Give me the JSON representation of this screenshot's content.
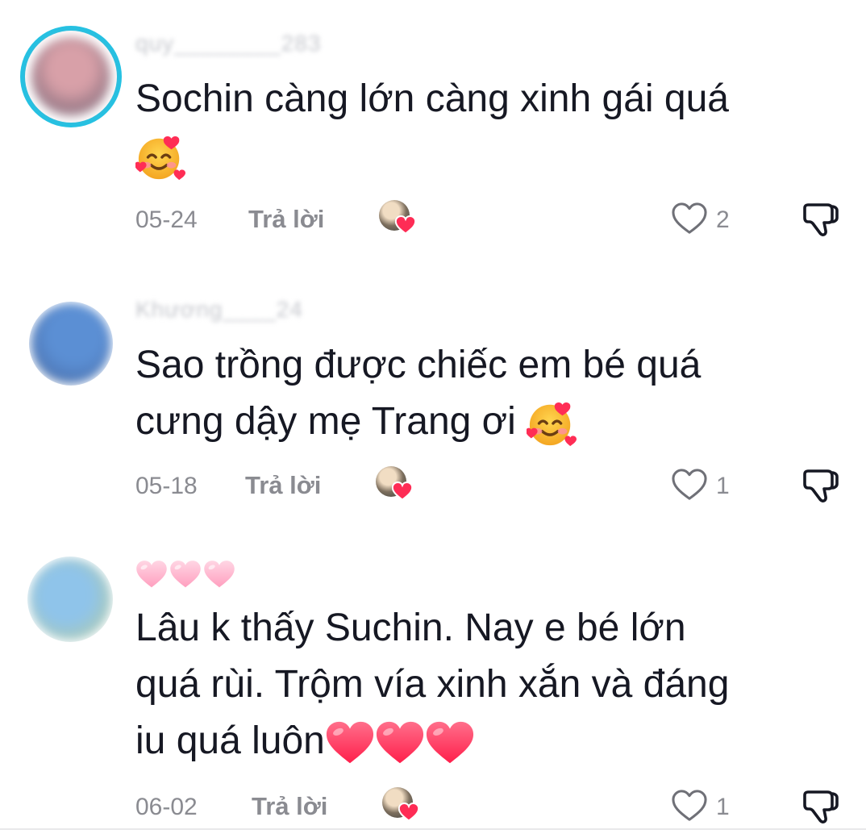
{
  "comments": [
    {
      "username": "quy________283",
      "text": "Sochin càng lớn càng xinh gái quá",
      "date": "05-24",
      "reply_label": "Trả lời",
      "likes": "2",
      "emoji": "smiling-face-with-hearts"
    },
    {
      "username": "Khương____24",
      "text_line1": "Sao trồng được chiếc em bé quá",
      "text_line2": "cưng dậy mẹ Trang ơi",
      "date": "05-18",
      "reply_label": "Trả lời",
      "likes": "1",
      "emoji": "smiling-face-with-hearts"
    },
    {
      "username_emoji": "pink-hearts",
      "text_line1": "Lâu k thấy Suchin. Nay e bé lớn",
      "text_line2": "quá rùi. Trộm vía xinh xắn và đáng",
      "text_line3": "iu quá luôn",
      "date": "06-02",
      "reply_label": "Trả lời",
      "likes": "1",
      "emoji": "red-hearts"
    }
  ],
  "colors": {
    "text": "#161823",
    "muted": "#8a8b91",
    "story_ring": "#25c2e3",
    "heart_red": "#fe2c55"
  },
  "icons": [
    "heart-outline-icon",
    "thumbs-down-icon",
    "creator-liked-badge-icon"
  ]
}
